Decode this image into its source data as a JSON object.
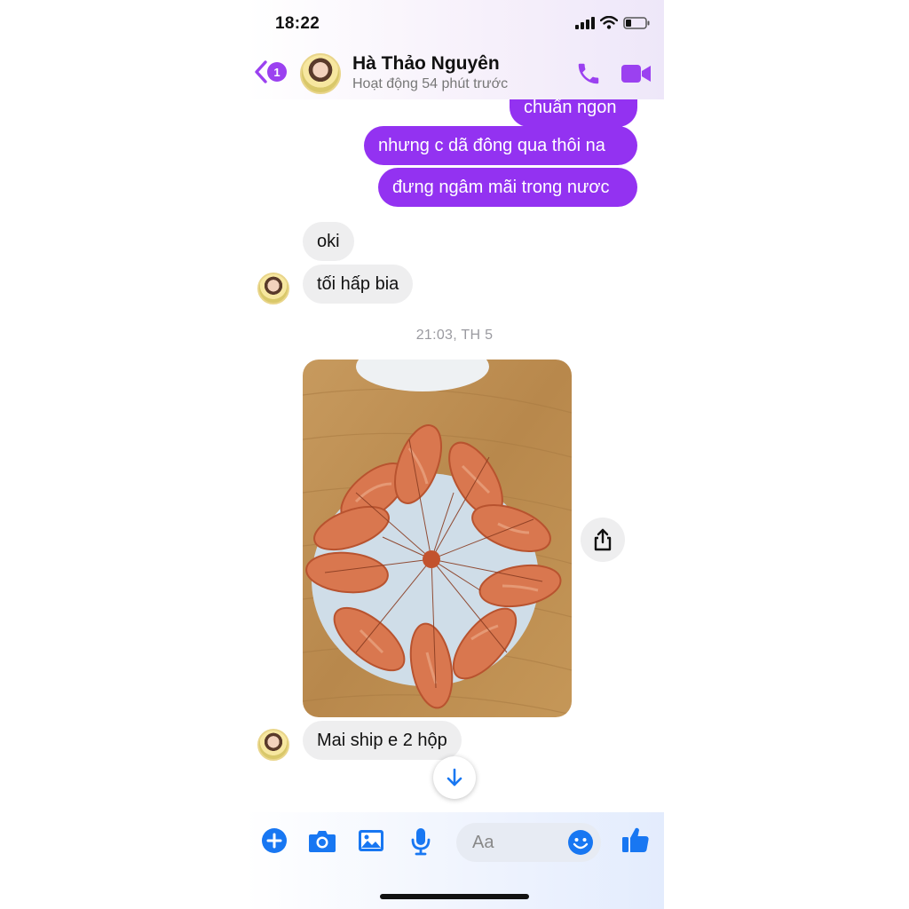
{
  "status_bar": {
    "time": "18:22"
  },
  "header": {
    "back_count": "1",
    "contact_name": "Hà Thảo Nguyên",
    "status": "Hoạt động 54 phút trước"
  },
  "messages": {
    "out_1": "chuẩn ngon",
    "out_2": "nhưng c dã đông qua thôi na",
    "out_3": "đưng ngâm mãi trong nươc",
    "in_1": "oki",
    "in_2": "tối hấp bia",
    "timestamp": "21:03, TH 5",
    "in_3": "Mai ship e 2 hộp"
  },
  "composer": {
    "placeholder": "Aa"
  },
  "colors": {
    "accent": "#9332f1",
    "composer_icons": "#1877f2",
    "incoming_bubble": "#eeeeef"
  }
}
